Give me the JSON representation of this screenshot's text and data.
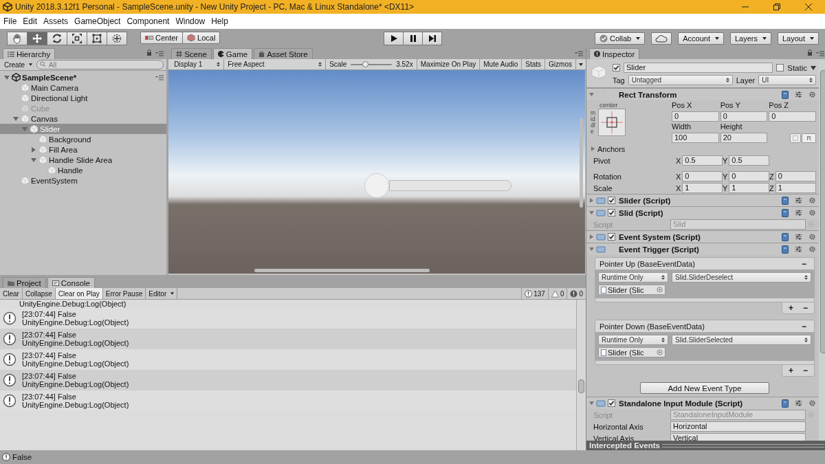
{
  "window": {
    "title": "Unity 2018.3.12f1 Personal - SampleScene.unity - New Unity Project - PC, Mac & Linux Standalone* <DX11>"
  },
  "menu": [
    "File",
    "Edit",
    "Assets",
    "GameObject",
    "Component",
    "Window",
    "Help"
  ],
  "toolbar": {
    "tools": [
      {
        "kind": "hand",
        "selected": false
      },
      {
        "kind": "move",
        "selected": true
      },
      {
        "kind": "rotate",
        "selected": false
      },
      {
        "kind": "scale",
        "selected": false
      },
      {
        "kind": "rect",
        "selected": false
      },
      {
        "kind": "transform",
        "selected": false
      }
    ],
    "pivot": [
      "Center",
      "Local"
    ],
    "collab": "Collab",
    "account": "Account",
    "layers": "Layers",
    "layout": "Layout"
  },
  "hierarchy": {
    "tab": "Hierarchy",
    "create": "Create",
    "search_placeholder": "All",
    "tree": [
      {
        "kind": "scene",
        "name": "SampleScene*",
        "expanded": true,
        "selected": false,
        "children": [
          {
            "kind": "object",
            "name": "Main Camera",
            "selected": false,
            "disabled": false
          },
          {
            "kind": "object",
            "name": "Directional Light",
            "selected": false,
            "disabled": false
          },
          {
            "kind": "object",
            "name": "Cube",
            "selected": false,
            "disabled": true
          },
          {
            "kind": "object",
            "name": "Canvas",
            "expanded": true,
            "selected": false,
            "disabled": false,
            "children": [
              {
                "kind": "object",
                "name": "Slider",
                "expanded": true,
                "selected": true,
                "disabled": false,
                "children": [
                  {
                    "kind": "object",
                    "name": "Background",
                    "selected": false,
                    "disabled": false
                  },
                  {
                    "kind": "object",
                    "name": "Fill Area",
                    "expanded": false,
                    "selected": false,
                    "disabled": false
                  },
                  {
                    "kind": "object",
                    "name": "Handle Slide Area",
                    "expanded": true,
                    "selected": false,
                    "disabled": false,
                    "children": [
                      {
                        "kind": "object",
                        "name": "Handle",
                        "selected": false,
                        "disabled": false
                      }
                    ]
                  }
                ]
              }
            ]
          },
          {
            "kind": "object",
            "name": "EventSystem",
            "selected": false,
            "disabled": false
          }
        ]
      }
    ]
  },
  "view_tabs": [
    {
      "label": "Scene",
      "selected": false
    },
    {
      "label": "Game",
      "selected": true
    },
    {
      "label": "Asset Store",
      "selected": false
    }
  ],
  "game_toolbar": {
    "display": "Display 1",
    "aspect": "Free Aspect",
    "scale_label": "Scale",
    "scale": {
      "level": 0.35
    },
    "scale_value": "3.52x",
    "toggles": [
      "Maximize On Play",
      "Mute Audio",
      "Stats"
    ],
    "gizmos": "Gizmos"
  },
  "bottom_tabs": [
    {
      "label": "Project",
      "selected": false
    },
    {
      "label": "Console",
      "selected": true
    }
  ],
  "console": {
    "toolbar": [
      {
        "label": "Clear",
        "on": false
      },
      {
        "label": "Collapse",
        "on": false
      },
      {
        "label": "Clear on Play",
        "on": true
      },
      {
        "label": "Error Pause",
        "on": false
      }
    ],
    "editor": "Editor",
    "counts": [
      {
        "kind": "info",
        "count": "137"
      },
      {
        "kind": "warning",
        "count": "0"
      },
      {
        "kind": "error",
        "count": "0"
      }
    ],
    "clipped_line": "UnityEngine.Debug:Log(Object)",
    "entries": [
      {
        "message": "[23:07:44] False",
        "detail": "UnityEngine.Debug:Log(Object)"
      },
      {
        "message": "[23:07:44] False",
        "detail": "UnityEngine.Debug:Log(Object)"
      },
      {
        "message": "[23:07:44] False",
        "detail": "UnityEngine.Debug:Log(Object)"
      },
      {
        "message": "[23:07:44] False",
        "detail": "UnityEngine.Debug:Log(Object)"
      },
      {
        "message": "[23:07:44] False",
        "detail": "UnityEngine.Debug:Log(Object)"
      }
    ]
  },
  "inspector": {
    "tab": "Inspector",
    "active": true,
    "name": "Slider",
    "static": {
      "label": "Static",
      "checked": false
    },
    "tag": {
      "label": "Tag",
      "value": "Untagged"
    },
    "layer": {
      "label": "Layer",
      "value": "UI"
    },
    "components": [
      {
        "kind": "rect_transform",
        "title": "Rect Transform",
        "expanded": true,
        "anchor_top": "center",
        "anchor_side": "middle",
        "pos": [
          {
            "label": "Pos X",
            "value": "0"
          },
          {
            "label": "Pos Y",
            "value": "0"
          },
          {
            "label": "Pos Z",
            "value": "0"
          }
        ],
        "size": [
          {
            "label": "Width",
            "value": "100"
          },
          {
            "label": "Height",
            "value": "20"
          }
        ],
        "raw_button": "R",
        "anchors": {
          "label": "Anchors",
          "expanded": false
        },
        "vectors": [
          {
            "label": "Pivot",
            "axes": [
              {
                "axis": "X",
                "value": "0.5"
              },
              {
                "axis": "Y",
                "value": "0.5"
              }
            ]
          },
          {
            "label": "Rotation",
            "axes": [
              {
                "axis": "X",
                "value": "0"
              },
              {
                "axis": "Y",
                "value": "0"
              },
              {
                "axis": "Z",
                "value": "0"
              }
            ]
          },
          {
            "label": "Scale",
            "axes": [
              {
                "axis": "X",
                "value": "1"
              },
              {
                "axis": "Y",
                "value": "1"
              },
              {
                "axis": "Z",
                "value": "1"
              }
            ]
          }
        ]
      },
      {
        "kind": "script",
        "title": "Slider (Script)",
        "expanded": false,
        "enabled": true
      },
      {
        "kind": "script",
        "title": "Slid (Script)",
        "expanded": true,
        "enabled": true,
        "fields": [
          {
            "label": "Script",
            "value": "Slid",
            "disabled": true
          }
        ]
      },
      {
        "kind": "script",
        "title": "Event System (Script)",
        "expanded": false,
        "enabled": true
      },
      {
        "kind": "event_trigger",
        "title": "Event Trigger (Script)",
        "expanded": true,
        "events": [
          {
            "title": "Pointer Up (BaseEventData)",
            "remove": "−",
            "mode": "Runtime Only",
            "function": "Slid.SliderDeselect",
            "target": "Slider (Slic",
            "add": "+",
            "minus": "−"
          },
          {
            "title": "Pointer Down (BaseEventData)",
            "remove": "−",
            "mode": "Runtime Only",
            "function": "Slid.SliderSelected",
            "target": "Slider (Slic",
            "add": "+",
            "minus": "−"
          }
        ],
        "add_button": "Add New Event Type"
      },
      {
        "kind": "script",
        "title": "Standalone Input Module (Script)",
        "expanded": true,
        "enabled": true,
        "fields": [
          {
            "label": "Script",
            "value": "StandaloneInputModule",
            "disabled": true
          },
          {
            "label": "Horizontal Axis",
            "value": "Horizontal",
            "disabled": false
          },
          {
            "label": "Vertical Axis",
            "value": "Vertical",
            "disabled": false
          }
        ]
      }
    ],
    "footer": "Intercepted Events"
  },
  "status": "False"
}
